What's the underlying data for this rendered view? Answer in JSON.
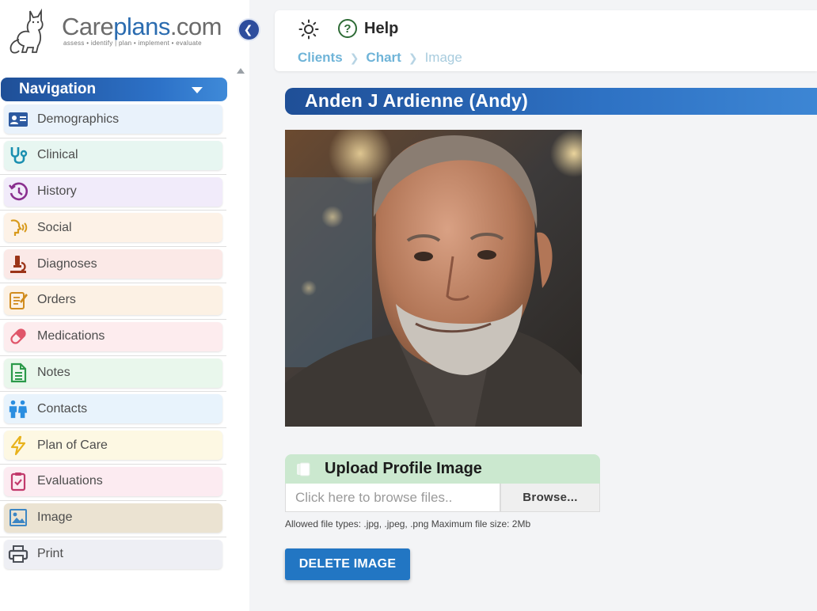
{
  "brand": {
    "logo_text_prefix": "Care",
    "logo_text_brand": "plans",
    "logo_text_suffix": ".com",
    "tagline": "assess • identify | plan • implement • evaluate",
    "logo_icon": "cat-logo"
  },
  "sidebar": {
    "nav_title": "Navigation",
    "items": [
      {
        "label": "Demographics",
        "icon": "id-card-icon",
        "bg": "#e9f2fb",
        "color": "#2d5aa0"
      },
      {
        "label": "Clinical",
        "icon": "stethoscope-icon",
        "bg": "#e7f6f1",
        "color": "#1a8fb0"
      },
      {
        "label": "History",
        "icon": "history-icon",
        "bg": "#f1ebfa",
        "color": "#8a2f8f"
      },
      {
        "label": "Social",
        "icon": "speaking-head-icon",
        "bg": "#fdf2e7",
        "color": "#d89a1c"
      },
      {
        "label": "Diagnoses",
        "icon": "microscope-icon",
        "bg": "#fbe9e7",
        "color": "#9b3418"
      },
      {
        "label": "Orders",
        "icon": "clipboard-edit-icon",
        "bg": "#fcf1e4",
        "color": "#d18c1e"
      },
      {
        "label": "Medications",
        "icon": "pill-icon",
        "bg": "#fdecee",
        "color": "#e0566a"
      },
      {
        "label": "Notes",
        "icon": "document-icon",
        "bg": "#e9f7ec",
        "color": "#2b9a4a"
      },
      {
        "label": "Contacts",
        "icon": "people-icon",
        "bg": "#e8f3fc",
        "color": "#2b8ee0"
      },
      {
        "label": "Plan of Care",
        "icon": "lightning-icon",
        "bg": "#fdf8e3",
        "color": "#e8b21a"
      },
      {
        "label": "Evaluations",
        "icon": "clipboard-check-icon",
        "bg": "#fcebf1",
        "color": "#c23a6c"
      },
      {
        "label": "Image",
        "icon": "image-icon",
        "bg": "#ebe3d2",
        "color": "#3c86c4"
      },
      {
        "label": "Print",
        "icon": "printer-icon",
        "bg": "#eeeff4",
        "color": "#4b4f57"
      }
    ]
  },
  "header": {
    "help_label": "Help",
    "help_glyph": "?",
    "breadcrumb": {
      "clients": "Clients",
      "chart": "Chart",
      "current": "Image"
    }
  },
  "patient": {
    "name": "Anden J Ardienne (Andy)"
  },
  "upload": {
    "title": "Upload Profile Image",
    "file_placeholder": "Click here to browse files..",
    "browse_label": "Browse...",
    "allowed_text": "Allowed file types: .jpg, .jpeg, .png  Maximum file size: 2Mb"
  },
  "actions": {
    "delete_label": "DELETE IMAGE"
  },
  "colors": {
    "primary_blue": "#2276c3",
    "nav_gradient_start": "#1f4f97",
    "breadcrumb_link": "#6fb4d8",
    "upload_header_bg": "#cbe8cf"
  }
}
